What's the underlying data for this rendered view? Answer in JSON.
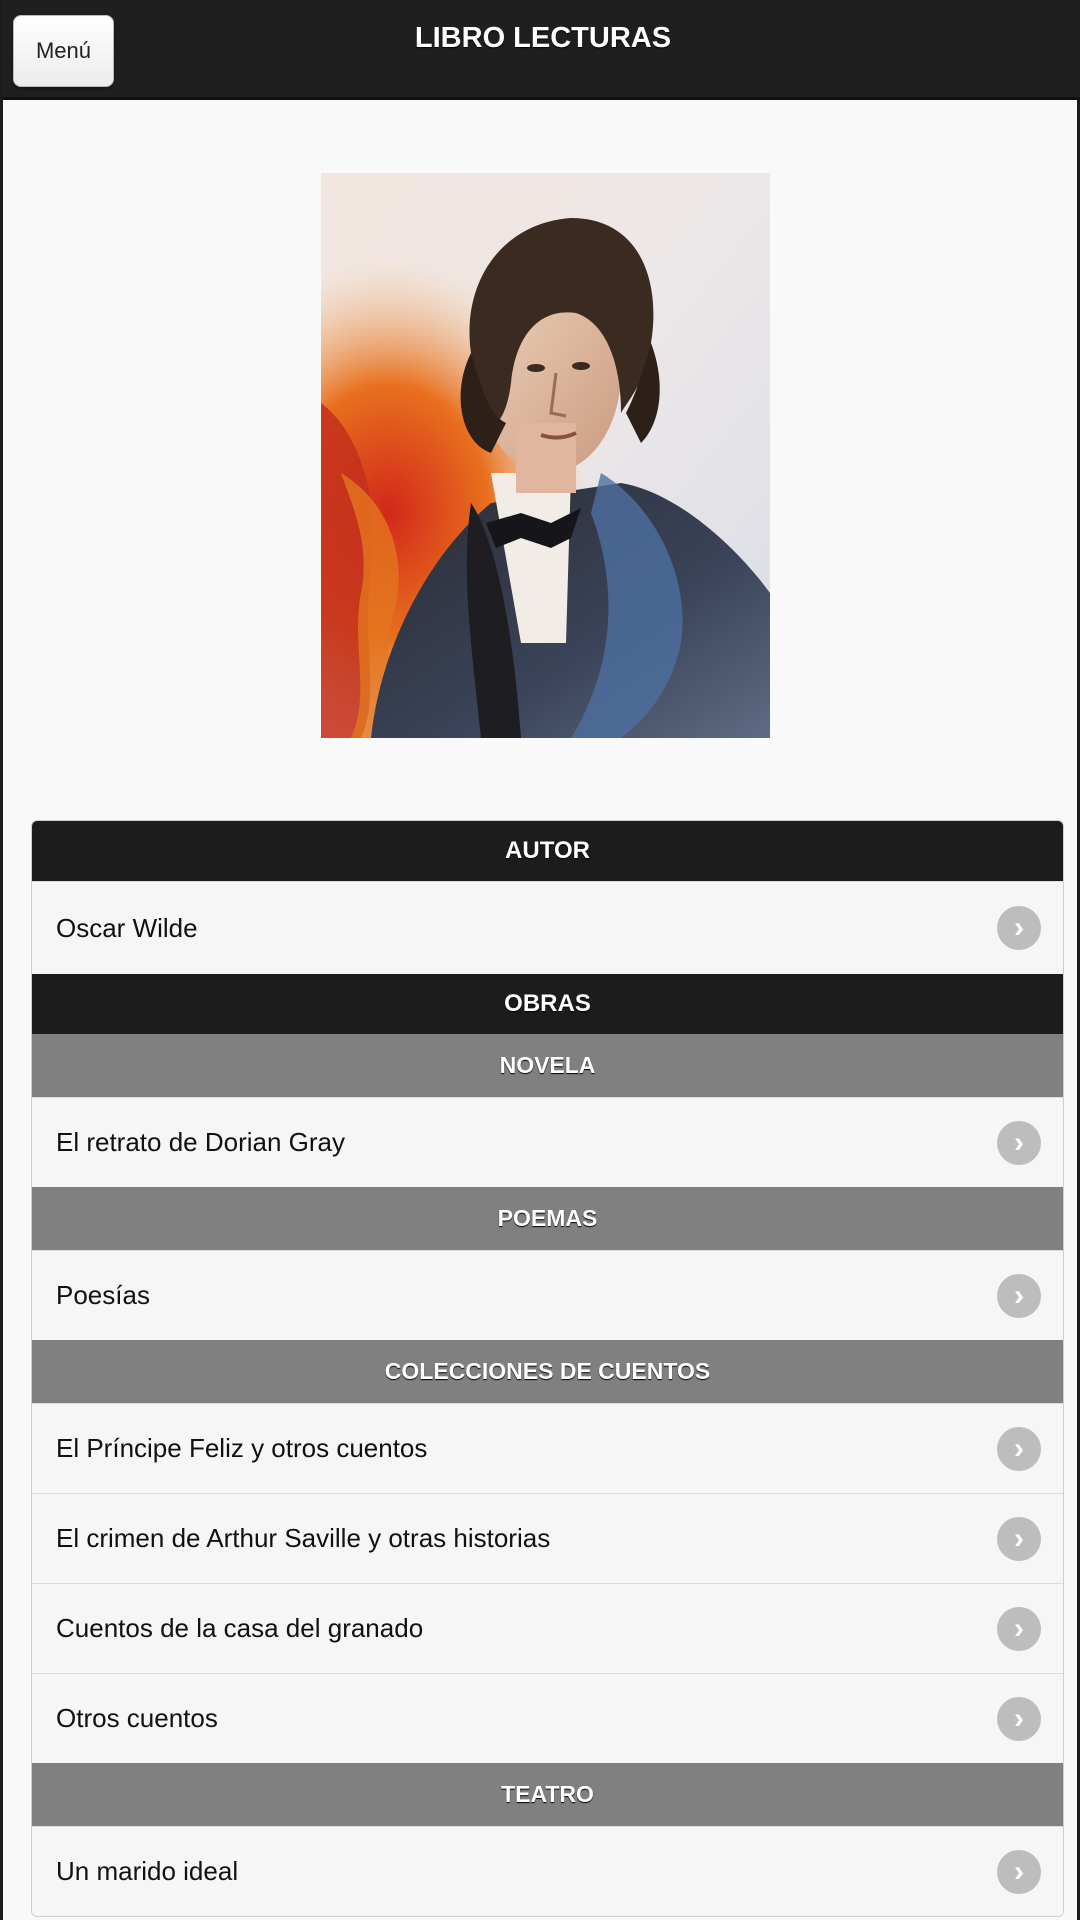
{
  "header": {
    "menu_label": "Menú",
    "title": "LIBRO LECTURAS"
  },
  "portrait": {
    "icon": "author-portrait-image"
  },
  "sections": {
    "autor": {
      "label": "AUTOR",
      "items": [
        "Oscar Wilde"
      ]
    },
    "obras": {
      "label": "OBRAS"
    },
    "novela": {
      "label": "NOVELA",
      "items": [
        "El retrato de Dorian Gray"
      ]
    },
    "poemas": {
      "label": "POEMAS",
      "items": [
        "Poesías"
      ]
    },
    "colecciones": {
      "label": "COLECCIONES DE CUENTOS",
      "items": [
        "El Príncipe Feliz y otros cuentos",
        "El crimen de Arthur Saville y otras historias",
        "Cuentos de la casa del granado",
        "Otros cuentos"
      ]
    },
    "teatro": {
      "label": "TEATRO",
      "items": [
        "Un marido ideal"
      ]
    }
  },
  "colors": {
    "header_bg": "#1f1f1f",
    "divider_dark": "#1c1c1c",
    "divider_gray": "#808080",
    "chevron": "#bdbdbd"
  }
}
